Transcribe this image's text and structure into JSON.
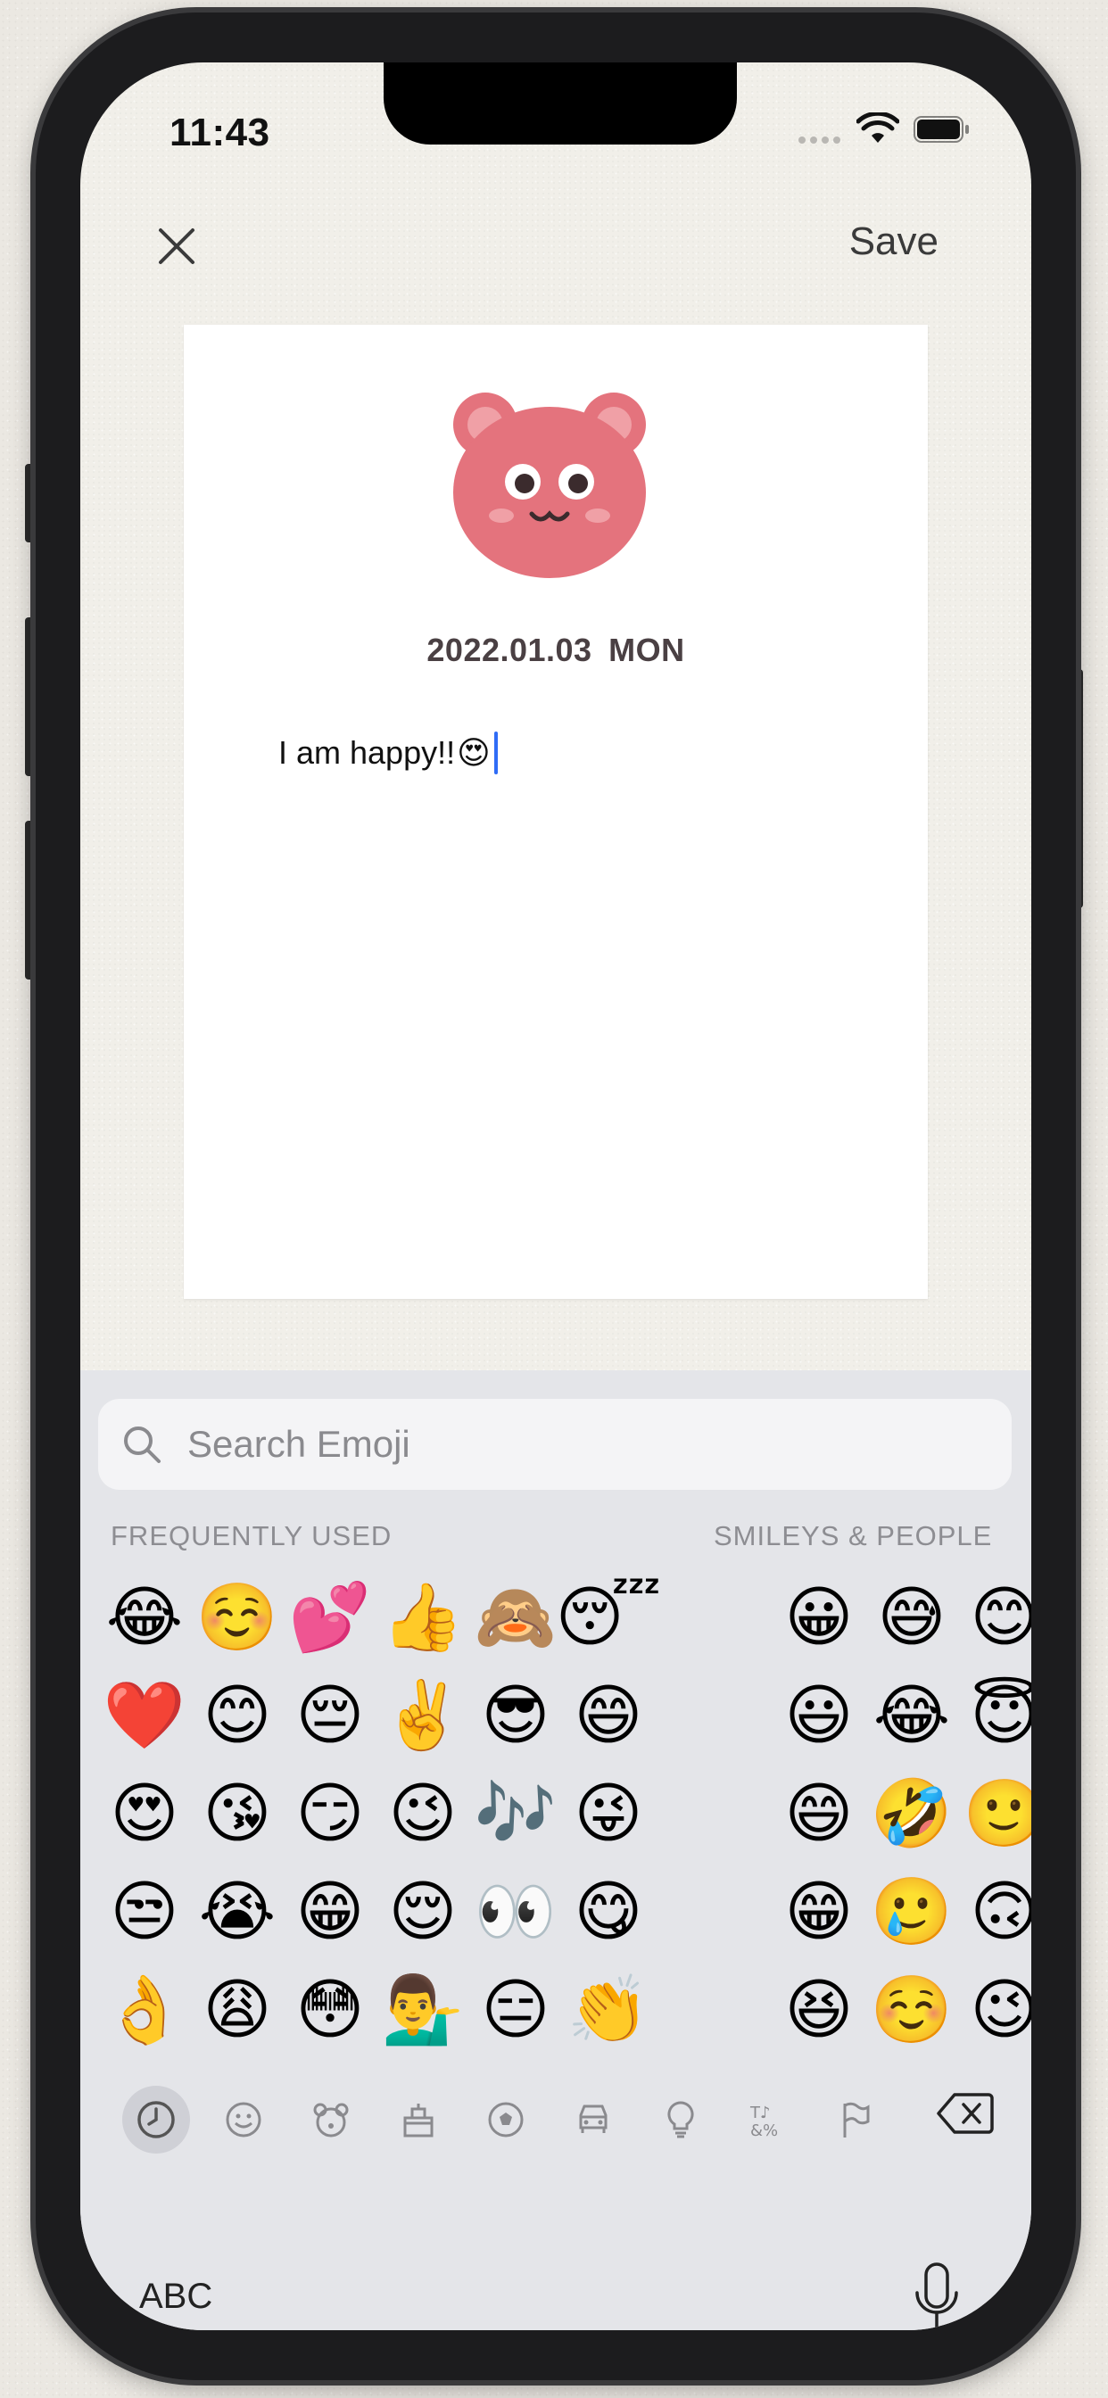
{
  "status_bar": {
    "time": "11:43"
  },
  "nav": {
    "save_label": "Save"
  },
  "diary": {
    "date": "2022.01.03  MON",
    "text": "I am happy!!",
    "text_emoji": "😍"
  },
  "keyboard": {
    "search_placeholder": "Search Emoji",
    "frequently_used_label": "FREQUENTLY USED",
    "smileys_label": "SMILEYS & PEOPLE",
    "frequently_used": [
      "😂",
      "☺️",
      "💕",
      "👍",
      "🙈",
      "😴",
      "❤️",
      "😊",
      "😔",
      "✌️",
      "😎",
      "😄",
      "😍",
      "😘",
      "😏",
      "😉",
      "🎶",
      "😜",
      "😒",
      "😭",
      "😁",
      "😌",
      "👀",
      "😋",
      "👌",
      "😩",
      "😳",
      "💁‍♂️",
      "😑",
      "👏"
    ],
    "smileys": [
      "😀",
      "😅",
      "😊",
      "😌",
      "😃",
      "😂",
      "😇",
      "🥰",
      "😄",
      "🤣",
      "🙂",
      "🥰",
      "😁",
      "🥲",
      "🙃",
      "😗",
      "😆",
      "☺️",
      "😉",
      "😙"
    ],
    "categories": [
      "recent-icon",
      "smiley-icon",
      "animal-icon",
      "food-icon",
      "activity-icon",
      "travel-icon",
      "objects-icon",
      "symbols-icon",
      "flags-icon"
    ],
    "abc_label": "ABC"
  },
  "colors": {
    "caret": "#2f6cf6",
    "keyboard_bg": "#e4e5e9",
    "bear": "#e4737d"
  }
}
